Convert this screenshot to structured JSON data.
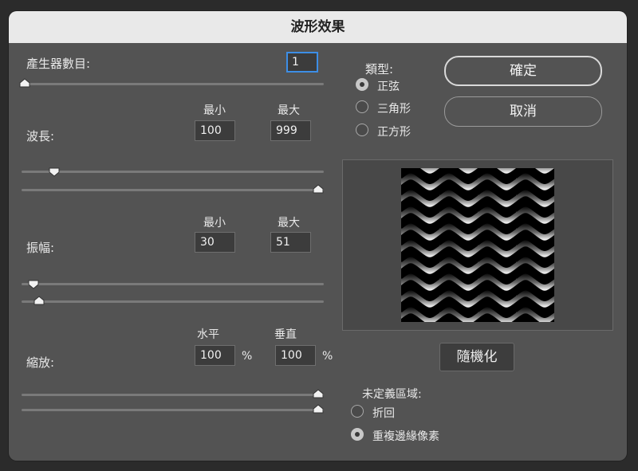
{
  "dialog": {
    "title": "波形效果"
  },
  "generators": {
    "label": "產生器數目:",
    "value": "1"
  },
  "wavelength": {
    "label": "波長:",
    "min_label": "最小",
    "max_label": "最大",
    "min": "100",
    "max": "999"
  },
  "amplitude": {
    "label": "振幅:",
    "min_label": "最小",
    "max_label": "最大",
    "min": "30",
    "max": "51"
  },
  "scale": {
    "label": "縮放:",
    "h_label": "水平",
    "v_label": "垂直",
    "h": "100",
    "v": "100",
    "unit": "%"
  },
  "type": {
    "label": "類型:",
    "options": [
      "正弦",
      "三角形",
      "正方形"
    ],
    "selected": "正弦"
  },
  "buttons": {
    "ok": "確定",
    "cancel": "取消",
    "randomize": "隨機化"
  },
  "undefined_areas": {
    "label": "未定義區域:",
    "options": [
      "折回",
      "重複邊緣像素"
    ],
    "selected": "重複邊緣像素"
  }
}
